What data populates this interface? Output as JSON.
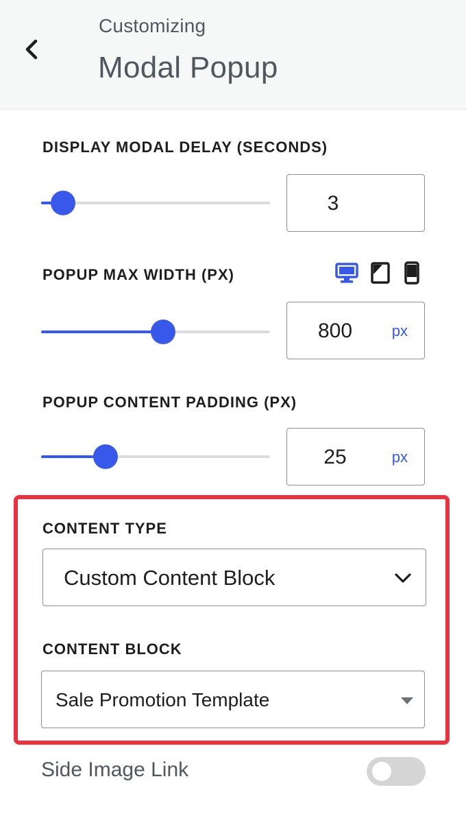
{
  "header": {
    "kicker": "Customizing",
    "title": "Modal Popup"
  },
  "delay": {
    "label": "Display Modal Delay (seconds)",
    "value": "3",
    "slider_fraction": 0.1
  },
  "max_width": {
    "label": "Popup Max Width (px)",
    "value": "800",
    "unit": "px",
    "slider_fraction": 0.53,
    "devices": [
      "desktop-icon",
      "tablet-icon",
      "mobile-icon"
    ],
    "active_device": "desktop"
  },
  "padding": {
    "label": "Popup Content Padding (px)",
    "value": "25",
    "unit": "px",
    "slider_fraction": 0.28
  },
  "content_type": {
    "label": "Content Type",
    "selected": "Custom Content Block"
  },
  "content_block": {
    "label": "Content Block",
    "selected": "Sale Promotion Template"
  },
  "side_image_link": {
    "label": "Side Image Link",
    "enabled": false
  },
  "colors": {
    "accent": "#3858e9",
    "highlight_border": "#e8323f",
    "header_bg": "#f6f7f7"
  }
}
